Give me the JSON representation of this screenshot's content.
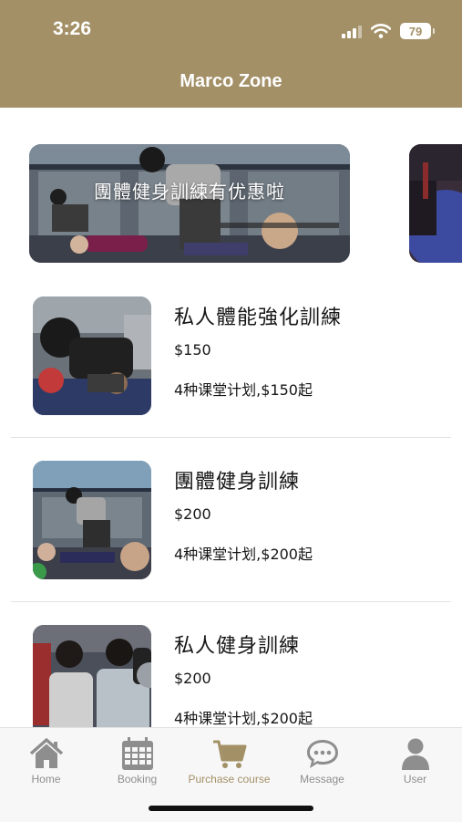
{
  "status_bar": {
    "time": "3:26",
    "battery": "79"
  },
  "header": {
    "title": "Marco Zone"
  },
  "banners": [
    {
      "text": "團體健身訓練有优惠啦"
    },
    {
      "text": ""
    }
  ],
  "courses": [
    {
      "name": "私人體能強化訓練",
      "price": "$150",
      "plans": "4种课堂计划,$150起"
    },
    {
      "name": "團體健身訓練",
      "price": "$200",
      "plans": "4种课堂计划,$200起"
    },
    {
      "name": "私人健身訓練",
      "price": "$200",
      "plans": "4种课堂计划,$200起"
    }
  ],
  "tabbar": {
    "active_color": "#a39067",
    "items": [
      {
        "label": "Home",
        "icon": "home-icon"
      },
      {
        "label": "Booking",
        "icon": "calendar-icon"
      },
      {
        "label": "Purchase course",
        "icon": "cart-icon"
      },
      {
        "label": "Message",
        "icon": "chat-bubble-icon"
      },
      {
        "label": "User",
        "icon": "user-icon"
      }
    ]
  },
  "theme": {
    "brand": "#a39067"
  }
}
